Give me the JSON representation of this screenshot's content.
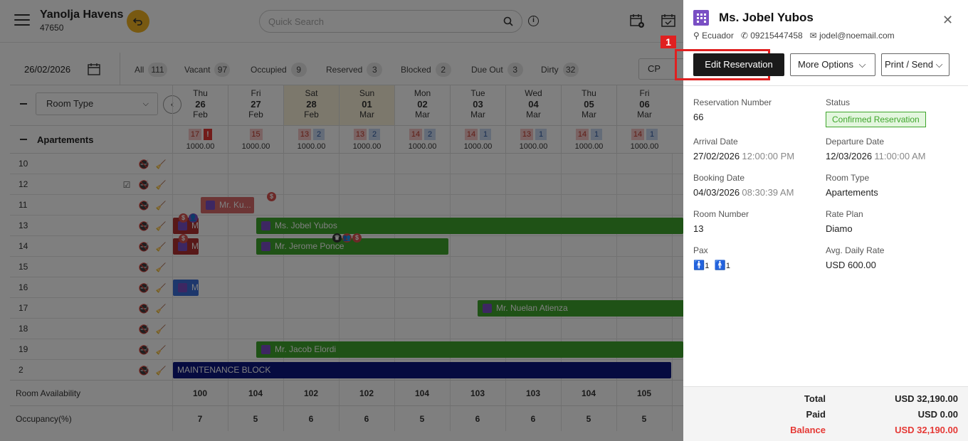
{
  "hotel": {
    "name": "Yanolja Havens",
    "id": "47650"
  },
  "search": {
    "placeholder": "Quick Search"
  },
  "statusbar": {
    "date": "26/02/2026",
    "filters": [
      {
        "label": "All",
        "count": "111"
      },
      {
        "label": "Vacant",
        "count": "97"
      },
      {
        "label": "Occupied",
        "count": "9"
      },
      {
        "label": "Reserved",
        "count": "3"
      },
      {
        "label": "Blocked",
        "count": "2"
      },
      {
        "label": "Due Out",
        "count": "3"
      },
      {
        "label": "Dirty",
        "count": "32"
      }
    ],
    "rate_select": "CP"
  },
  "grid": {
    "room_type_select": "Room Type",
    "category": "Apartements",
    "days": [
      {
        "dow": "Thu",
        "day": "26",
        "mon": "Feb",
        "weekend": false,
        "occ": "17",
        "blk": "",
        "alert": "!",
        "price": "1000.00"
      },
      {
        "dow": "Fri",
        "day": "27",
        "mon": "Feb",
        "weekend": false,
        "occ": "15",
        "blk": "",
        "alert": "",
        "price": "1000.00"
      },
      {
        "dow": "Sat",
        "day": "28",
        "mon": "Feb",
        "weekend": true,
        "occ": "13",
        "blk": "2",
        "alert": "",
        "price": "1000.00"
      },
      {
        "dow": "Sun",
        "day": "01",
        "mon": "Mar",
        "weekend": true,
        "occ": "13",
        "blk": "2",
        "alert": "",
        "price": "1000.00"
      },
      {
        "dow": "Mon",
        "day": "02",
        "mon": "Mar",
        "weekend": false,
        "occ": "14",
        "blk": "2",
        "alert": "",
        "price": "1000.00"
      },
      {
        "dow": "Tue",
        "day": "03",
        "mon": "Mar",
        "weekend": false,
        "occ": "14",
        "blk": "1",
        "alert": "",
        "price": "1000.00"
      },
      {
        "dow": "Wed",
        "day": "04",
        "mon": "Mar",
        "weekend": false,
        "occ": "13",
        "blk": "1",
        "alert": "",
        "price": "1000.00"
      },
      {
        "dow": "Thu",
        "day": "05",
        "mon": "Mar",
        "weekend": false,
        "occ": "14",
        "blk": "1",
        "alert": "",
        "price": "1000.00"
      },
      {
        "dow": "Fri",
        "day": "06",
        "mon": "Mar",
        "weekend": false,
        "occ": "14",
        "blk": "1",
        "alert": "",
        "price": "1000.00"
      }
    ],
    "rooms": [
      "10",
      "12",
      "11",
      "13",
      "14",
      "15",
      "16",
      "17",
      "18",
      "19",
      "2"
    ],
    "bookings": [
      {
        "room": "11",
        "label": "Mr. Ku...",
        "color": "pink"
      },
      {
        "room": "13",
        "label": "M",
        "color": "red"
      },
      {
        "room": "13",
        "label": "Ms. Jobel Yubos",
        "color": "green"
      },
      {
        "room": "14",
        "label": "M",
        "color": "red"
      },
      {
        "room": "14",
        "label": "Mr. Jerome Ponce",
        "color": "green"
      },
      {
        "room": "16",
        "label": "M",
        "color": "blue"
      },
      {
        "room": "17",
        "label": "Mr. Nuelan Atienza",
        "color": "green"
      },
      {
        "room": "19",
        "label": "Mr. Jacob Elordi",
        "color": "green"
      },
      {
        "room": "2",
        "label": "MAINTENANCE BLOCK",
        "color": "navy"
      }
    ],
    "availability_label": "Room Availability",
    "availability": [
      "100",
      "104",
      "102",
      "102",
      "104",
      "103",
      "103",
      "104",
      "105"
    ],
    "occupancy_label": "Occupancy(%)",
    "occupancy": [
      "7",
      "5",
      "6",
      "6",
      "5",
      "6",
      "6",
      "5",
      "5"
    ]
  },
  "panel": {
    "guest_name": "Ms. Jobel Yubos",
    "country": "Ecuador",
    "phone": "09215447458",
    "email": "jodel@noemail.com",
    "edit_button": "Edit Reservation",
    "more_button": "More Options",
    "print_button": "Print / Send",
    "highlight_number": "1",
    "fields": {
      "res_no_label": "Reservation Number",
      "res_no": "66",
      "status_label": "Status",
      "status": "Confirmed Reservation",
      "arrival_label": "Arrival Date",
      "arrival_date": "27/02/2026",
      "arrival_time": "12:00:00 PM",
      "departure_label": "Departure Date",
      "departure_date": "12/03/2026",
      "departure_time": "11:00:00 AM",
      "booking_label": "Booking Date",
      "booking_date": "04/03/2026",
      "booking_time": "08:30:39 AM",
      "room_type_label": "Room Type",
      "room_type": "Apartements",
      "room_no_label": "Room Number",
      "room_no": "13",
      "rate_plan_label": "Rate Plan",
      "rate_plan": "Diamo",
      "pax_label": "Pax",
      "pax_adults": "1",
      "pax_children": "1",
      "adr_label": "Avg. Daily Rate",
      "adr": "USD 600.00"
    },
    "totals": {
      "total_label": "Total",
      "total": "USD 32,190.00",
      "paid_label": "Paid",
      "paid": "USD 0.00",
      "balance_label": "Balance",
      "balance": "USD 32,190.00"
    },
    "balance_color": "#e53935"
  }
}
